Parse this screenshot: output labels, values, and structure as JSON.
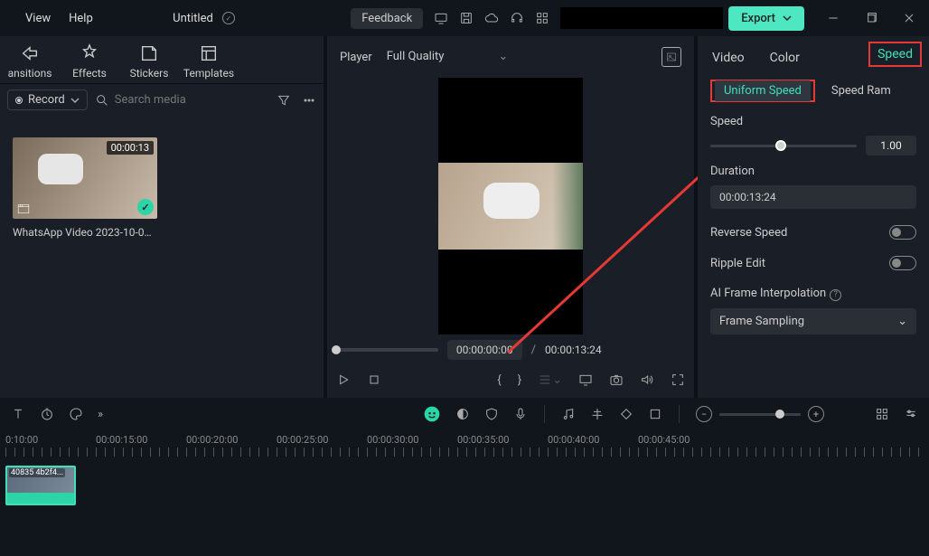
{
  "menu": {
    "view": "View",
    "help": "Help"
  },
  "title": "Untitled",
  "feedback": "Feedback",
  "export": "Export",
  "toolbar": {
    "transitions": "ansitions",
    "effects": "Effects",
    "stickers": "Stickers",
    "templates": "Templates"
  },
  "media": {
    "record": "Record",
    "search_placeholder": "Search media",
    "clip_duration": "00:00:13",
    "clip_name": "WhatsApp Video 2023-10-05..."
  },
  "player": {
    "label": "Player",
    "quality": "Full Quality",
    "current": "00:00:00:00",
    "total": "00:00:13:24",
    "sep": "/"
  },
  "panel": {
    "tabs": {
      "video": "Video",
      "color": "Color",
      "speed": "Speed"
    },
    "subtabs": {
      "uniform": "Uniform Speed",
      "ramp": "Speed Ram"
    },
    "speed_label": "Speed",
    "speed_value": "1.00",
    "duration_label": "Duration",
    "duration_value": "00:00:13:24",
    "reverse": "Reverse Speed",
    "ripple": "Ripple Edit",
    "ai": "AI Frame Interpolation",
    "ai_option": "Frame Sampling"
  },
  "timeline": {
    "marks": [
      "0:10:00",
      "00:00:15:00",
      "00:00:20:00",
      "00:00:25:00",
      "00:00:30:00",
      "00:00:35:00",
      "00:00:40:00",
      "00:00:45:00"
    ],
    "clip_label": "40835 4b2f4..."
  }
}
